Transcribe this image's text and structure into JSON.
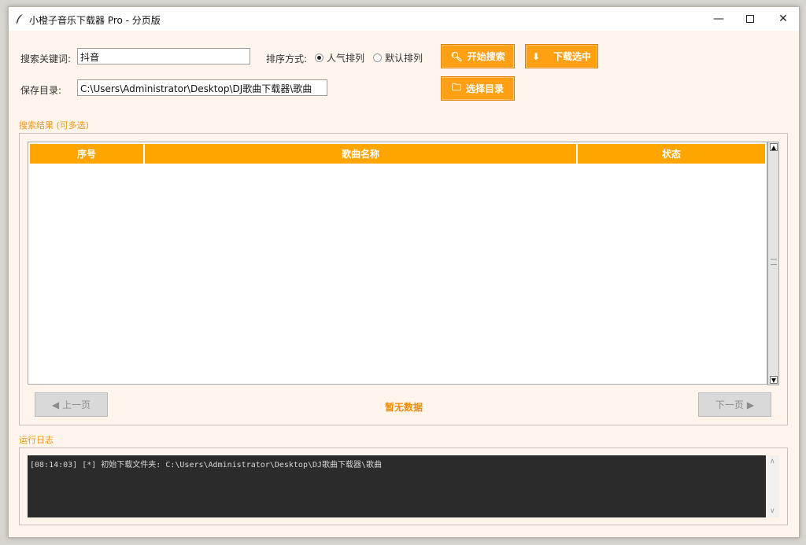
{
  "window": {
    "title": "小橙子音乐下载器 Pro - 分页版",
    "minimize": "—",
    "close": "✕"
  },
  "search": {
    "keyword_label": "搜索关键词:",
    "keyword_value": "抖音",
    "sort_label": "排序方式:",
    "sort_options": [
      "人气排列",
      "默认排列"
    ],
    "sort_selected": "人气排列",
    "save_label": "保存目录:",
    "save_value": "C:\\Users\\Administrator\\Desktop\\DJ歌曲下载器\\歌曲"
  },
  "buttons": {
    "search": "开始搜索",
    "download": "下载选中",
    "choose_dir": "选择目录",
    "prev_page": "上一页",
    "next_page": "下一页"
  },
  "results": {
    "section_title": "搜索结果 (可多选)",
    "columns": [
      "序号",
      "歌曲名称",
      "状态"
    ],
    "rows": [],
    "page_status": "暂无数据"
  },
  "log": {
    "section_title": "运行日志",
    "lines": [
      "[08:14:03] [*] 初始下载文件夹: C:\\Users\\Administrator\\Desktop\\DJ歌曲下载器\\歌曲"
    ]
  },
  "colors": {
    "accent": "#ffa500",
    "window_bg": "#fff5ec",
    "log_bg": "#2b2b2b"
  }
}
